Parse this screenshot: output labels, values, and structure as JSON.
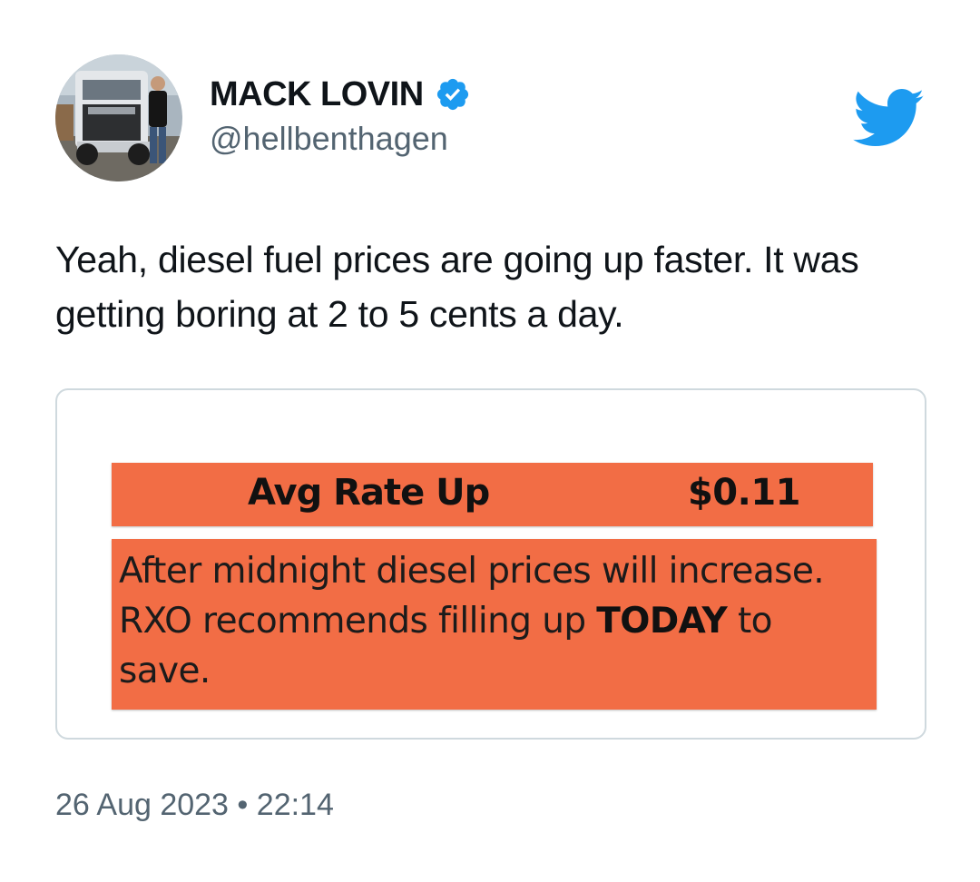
{
  "author": {
    "display_name": "MACK LOVIN",
    "handle": "@hellbenthagen",
    "verified": true,
    "avatar": "avatar-photo-man-with-truck"
  },
  "platform_icon": "twitter-bird-icon",
  "tweet": {
    "text": "Yeah, diesel fuel prices are going up faster. It was getting boring at 2 to 5 cents a day."
  },
  "media": {
    "rate_label": "Avg Rate Up",
    "rate_value": "$0.11",
    "notice_text": "After midnight diesel prices will increase. RXO recommends filling up",
    "notice_emphasis": "TODAY",
    "notice_tail": "to save.",
    "accent_color": "#f26d45"
  },
  "timestamp": {
    "date": "26 Aug 2023",
    "separator": "•",
    "time": "22:14"
  },
  "colors": {
    "twitter_blue": "#1d9bf0",
    "secondary_text": "#536471"
  }
}
